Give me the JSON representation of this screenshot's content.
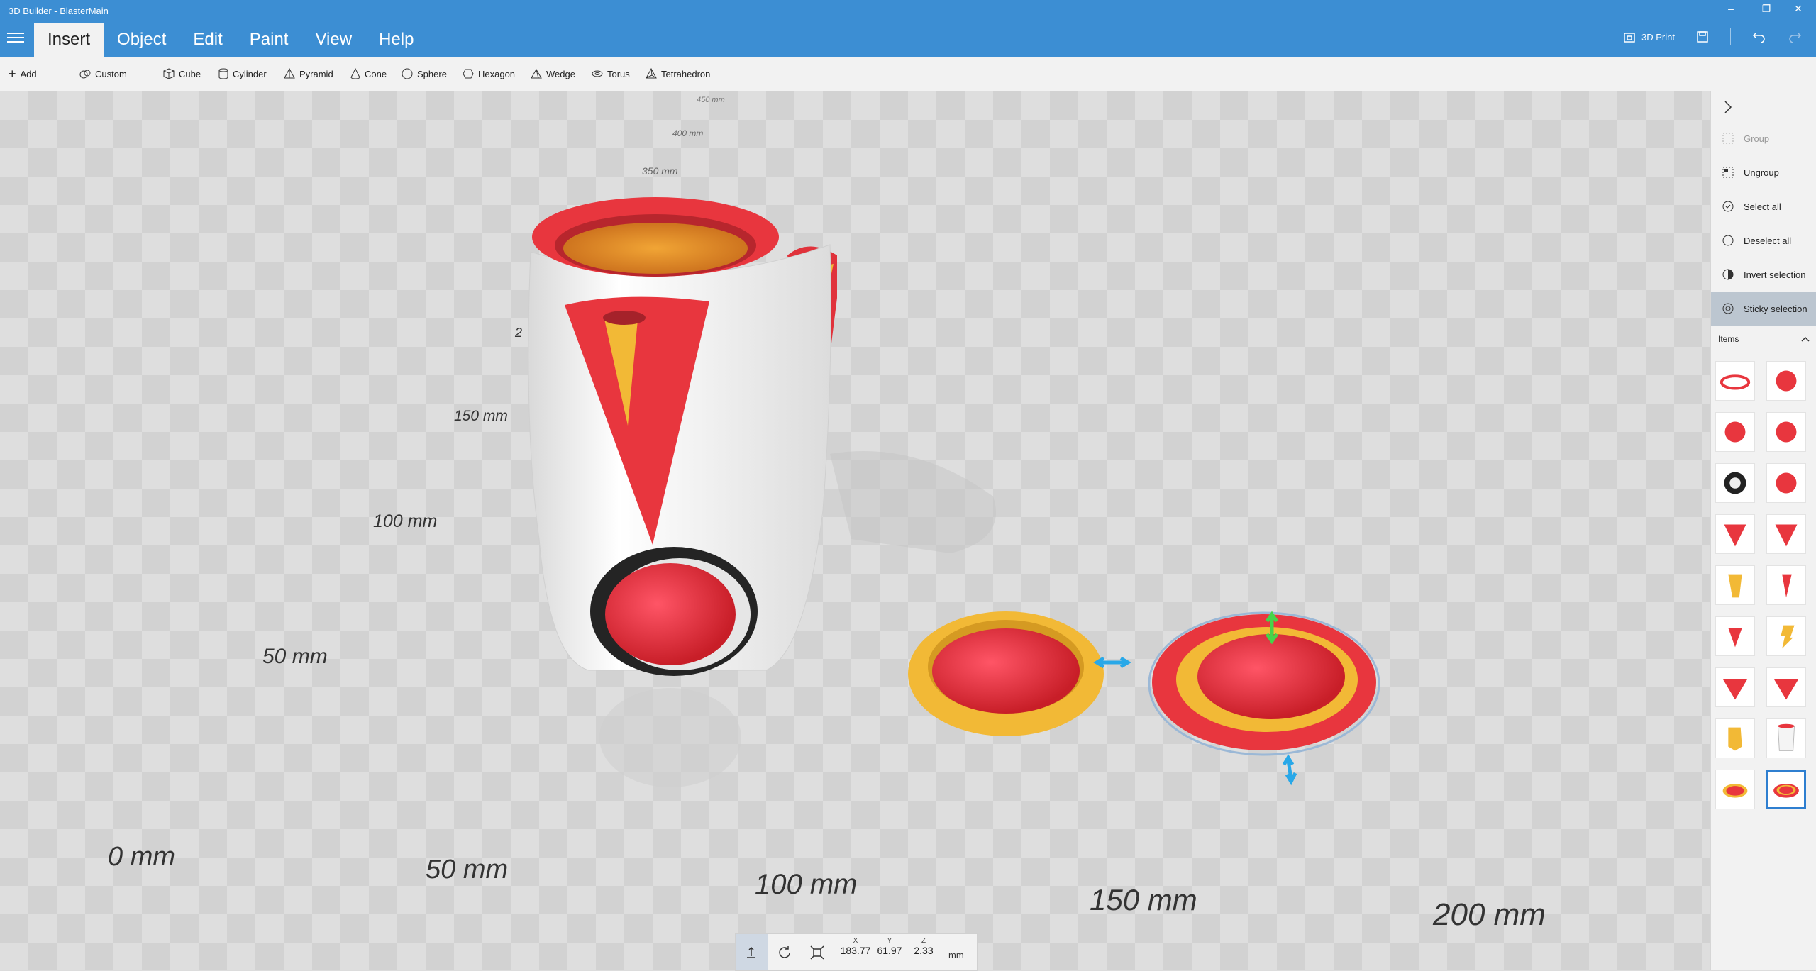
{
  "window": {
    "title": "3D Builder - BlasterMain",
    "minimize": "–",
    "restore": "❐",
    "close": "✕"
  },
  "menu": {
    "tabs": [
      {
        "label": "Insert"
      },
      {
        "label": "Object"
      },
      {
        "label": "Edit"
      },
      {
        "label": "Paint"
      },
      {
        "label": "View"
      },
      {
        "label": "Help"
      }
    ],
    "active": "Insert"
  },
  "header_actions": {
    "print_label": "3D Print"
  },
  "toolbar": {
    "add": "Add",
    "custom": "Custom",
    "cube": "Cube",
    "cylinder": "Cylinder",
    "pyramid": "Pyramid",
    "cone": "Cone",
    "sphere": "Sphere",
    "hexagon": "Hexagon",
    "wedge": "Wedge",
    "torus": "Torus",
    "tetrahedron": "Tetrahedron"
  },
  "viewport": {
    "rulers": [
      "450 mm",
      "400 mm",
      "350 mm",
      "2",
      "150 mm",
      "100 mm",
      "50 mm",
      "0 mm",
      "50 mm",
      "100 mm",
      "150 mm",
      "200 mm"
    ]
  },
  "status": {
    "x_label": "X",
    "y_label": "Y",
    "z_label": "Z",
    "x": "183.77",
    "y": "61.97",
    "z": "2.33",
    "unit": "mm"
  },
  "right_panel": {
    "group": "Group",
    "ungroup": "Ungroup",
    "select_all": "Select all",
    "deselect_all": "Deselect all",
    "invert_selection": "Invert selection",
    "sticky_selection": "Sticky selection",
    "items_title": "Items"
  },
  "items": [
    "red-ring",
    "red-sphere",
    "red-sphere",
    "red-sphere",
    "black-ring",
    "red-sphere",
    "red-cone",
    "red-cone",
    "yellow-tube",
    "red-cone-thin",
    "red-cone-small",
    "yellow-shape",
    "red-cone-wide",
    "red-cone-wide",
    "yellow-block",
    "white-cup",
    "red-disc-yellow",
    "red-disc-yellow-selected"
  ],
  "colors": {
    "accent": "#3c8ed3",
    "red": "#e8363e",
    "yellow": "#f2b936",
    "selection": "#2f7fd0"
  }
}
